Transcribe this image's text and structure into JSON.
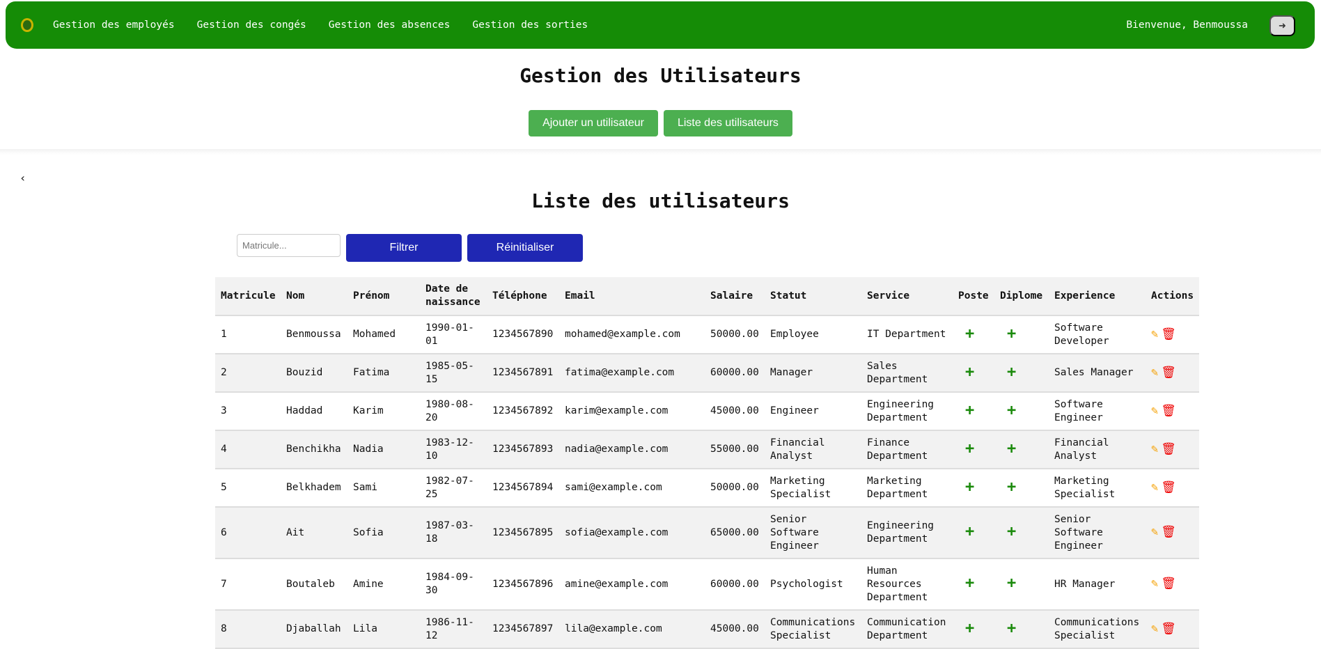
{
  "nav": {
    "items": [
      "Gestion des employés",
      "Gestion des congés",
      "Gestion des absences",
      "Gestion des sorties"
    ],
    "welcome": "Bienvenue, Benmoussa",
    "logout_icon": "sign-out-icon",
    "color": "#158c06"
  },
  "page": {
    "title": "Gestion des Utilisateurs",
    "add_button": "Ajouter un utilisateur",
    "list_button": "Liste des utilisateurs",
    "back_icon": "‹"
  },
  "list": {
    "title": "Liste des utilisateurs",
    "filter_placeholder": "Matricule...",
    "filter_value": "",
    "filter_button": "Filtrer",
    "reset_button": "Réinitialiser",
    "columns": [
      "Matricule",
      "Nom",
      "Prénom",
      "Date de naissance",
      "Téléphone",
      "Email",
      "Salaire",
      "Statut",
      "Service",
      "Poste",
      "Diplome",
      "Experience",
      "Actions"
    ],
    "rows": [
      [
        "1",
        "Benmoussa",
        "Mohamed",
        "1990-01-01",
        "1234567890",
        "mohamed@example.com",
        "50000.00",
        "Employee",
        "IT Department",
        "Software Developer"
      ],
      [
        "2",
        "Bouzid",
        "Fatima",
        "1985-05-15",
        "1234567891",
        "fatima@example.com",
        "60000.00",
        "Manager",
        "Sales Department",
        "Sales Manager"
      ],
      [
        "3",
        "Haddad",
        "Karim",
        "1980-08-20",
        "1234567892",
        "karim@example.com",
        "45000.00",
        "Engineer",
        "Engineering Department",
        "Software Engineer"
      ],
      [
        "4",
        "Benchikha",
        "Nadia",
        "1983-12-10",
        "1234567893",
        "nadia@example.com",
        "55000.00",
        "Financial Analyst",
        "Finance Department",
        "Financial Analyst"
      ],
      [
        "5",
        "Belkhadem",
        "Sami",
        "1982-07-25",
        "1234567894",
        "sami@example.com",
        "50000.00",
        "Marketing Specialist",
        "Marketing Department",
        "Marketing Specialist"
      ],
      [
        "6",
        "Ait",
        "Sofia",
        "1987-03-18",
        "1234567895",
        "sofia@example.com",
        "65000.00",
        "Senior Software Engineer",
        "Engineering Department",
        "Senior Software Engineer"
      ],
      [
        "7",
        "Boutaleb",
        "Amine",
        "1984-09-30",
        "1234567896",
        "amine@example.com",
        "60000.00",
        "Psychologist",
        "Human Resources Department",
        "HR Manager"
      ],
      [
        "8",
        "Djaballah",
        "Lila",
        "1986-11-12",
        "1234567897",
        "lila@example.com",
        "45000.00",
        "Communications Specialist",
        "Communication Department",
        "Communications Specialist"
      ]
    ],
    "poste_icon": "plus-icon",
    "diplome_icon": "plus-icon",
    "action_icons": [
      "edit-icon",
      "trash-icon"
    ],
    "colors": {
      "filter_button": "#1f27b3",
      "green_button": "#4caf50",
      "edit": "#f5a000",
      "delete": "#e00000"
    }
  }
}
